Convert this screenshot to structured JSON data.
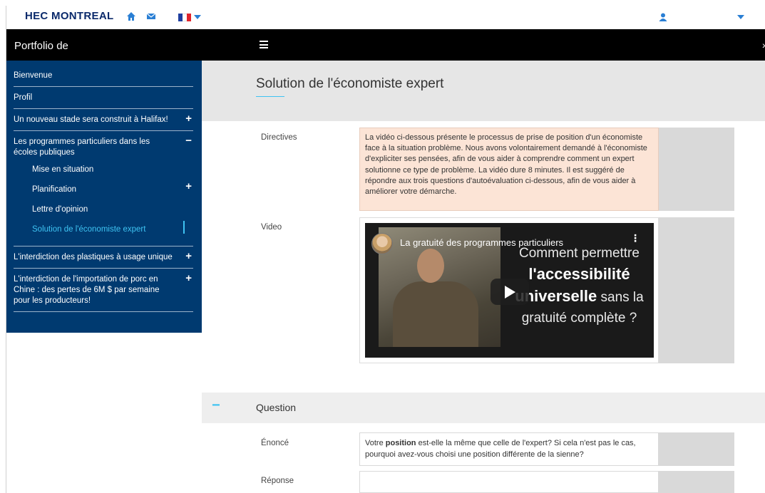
{
  "topbar": {
    "logo": "HEC MONTREAL",
    "icons": [
      "home-icon",
      "mail-icon",
      "flag-fr-icon",
      "user-icon",
      "chevron-down-icon"
    ],
    "flag_colors": [
      "#1f3fa0",
      "#ffffff",
      "#e0242b"
    ]
  },
  "header": {
    "portfolio_title": "Portfolio de",
    "menu_icon": "hamburger-icon"
  },
  "sidebar": {
    "items": [
      {
        "label": "Bienvenue"
      },
      {
        "label": "Profil"
      },
      {
        "label": "Un nouveau stade sera construit à Halifax!",
        "toggle": "+"
      },
      {
        "label": "Les programmes particuliers dans les écoles publiques",
        "toggle": "−",
        "children": [
          {
            "label": "Mise en situation"
          },
          {
            "label": "Planification",
            "toggle": "+"
          },
          {
            "label": "Lettre d'opinion"
          },
          {
            "label": "Solution de l'économiste expert",
            "active": true
          }
        ]
      },
      {
        "label": "L'interdiction des plastiques à usage unique",
        "toggle": "+"
      },
      {
        "label": "L'interdiction de l'importation de porc en Chine : des pertes de 6M $ par semaine pour les producteurs!",
        "toggle": "+"
      }
    ]
  },
  "main": {
    "page_title": "Solution de l'économiste expert",
    "directives_label": "Directives",
    "directives_text": "La vidéo ci-dessous présente le processus de prise de position d'un économiste face à la situation problème. Nous avons volontairement demandé à l'économiste d'expliciter ses pensées, afin de vous aider à comprendre comment un expert solutionne ce type de problème. La vidéo dure 8 minutes. Il est suggéré de répondre aux trois questions d'autoévaluation ci-dessous, afin de vous aider à améliorer votre démarche.",
    "video_label": "Video",
    "video": {
      "title": "La gratuité des programmes particuliers",
      "overlay_line1": "Comment permettre",
      "overlay_line2": "l'accessibilité",
      "overlay_line3a": "universelle",
      "overlay_line3b": " sans la",
      "overlay_line4": "gratuité complète ?"
    },
    "question_section": {
      "toggle": "−",
      "title": "Question",
      "enonce_label": "Énoncé",
      "enonce_before": "Votre ",
      "enonce_bold": "position",
      "enonce_after": " est-elle la même que celle de l'expert? Si cela n'est pas le cas, pourquoi avez-vous choisi une position différente de la sienne?",
      "reponse_label": "Réponse",
      "reponse_value": ""
    }
  },
  "colors": {
    "sidebar_bg": "#003a70",
    "accent": "#3ec3f2",
    "directives_bg": "#fce4d6",
    "header_bg": "#000000"
  }
}
